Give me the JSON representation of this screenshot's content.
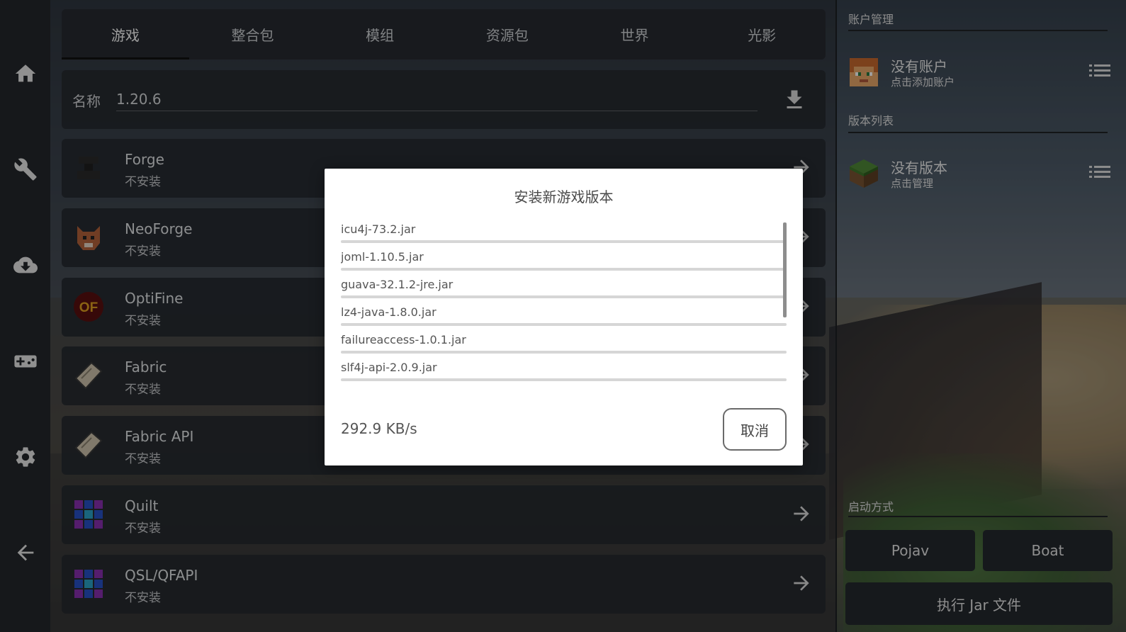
{
  "sidebar": {
    "items": [
      {
        "icon": "home-icon"
      },
      {
        "icon": "wrench-icon"
      },
      {
        "icon": "cloud-download-icon"
      },
      {
        "icon": "gamepad-icon"
      },
      {
        "icon": "gear-icon"
      },
      {
        "icon": "back-arrow-icon"
      }
    ]
  },
  "tabs": [
    "游戏",
    "整合包",
    "模组",
    "资源包",
    "世界",
    "光影"
  ],
  "active_tab": "游戏",
  "name_field": {
    "label": "名称",
    "value": "1.20.6"
  },
  "loaders": [
    {
      "title": "Forge",
      "status": "不安装",
      "icon": "forge-anvil-icon"
    },
    {
      "title": "NeoForge",
      "status": "不安装",
      "icon": "neoforge-fox-icon"
    },
    {
      "title": "OptiFine",
      "status": "不安装",
      "icon": "optifine-logo-icon"
    },
    {
      "title": "Fabric",
      "status": "不安装",
      "icon": "fabric-scroll-icon"
    },
    {
      "title": "Fabric API",
      "status": "不安装",
      "icon": "fabric-api-scroll-icon"
    },
    {
      "title": "Quilt",
      "status": "不安装",
      "icon": "quilt-patchwork-icon"
    },
    {
      "title": "QSL/QFAPI",
      "status": "不安装",
      "icon": "qsl-patchwork-icon"
    }
  ],
  "right_panel": {
    "account_section": "账户管理",
    "account": {
      "name": "没有账户",
      "sub": "点击添加账户"
    },
    "version_section": "版本列表",
    "version": {
      "name": "没有版本",
      "sub": "点击管理"
    },
    "launch_section": "启动方式",
    "launch_buttons": [
      "Pojav",
      "Boat"
    ],
    "jar_button": "执行 Jar 文件"
  },
  "dialog": {
    "title": "安装新游戏版本",
    "files": [
      "icu4j-73.2.jar",
      "joml-1.10.5.jar",
      "guava-32.1.2-jre.jar",
      "lz4-java-1.8.0.jar",
      "failureaccess-1.0.1.jar",
      "slf4j-api-2.0.9.jar"
    ],
    "speed": "292.9 KB/s",
    "cancel_label": "取消"
  },
  "colors": {
    "rail_bg": "#24282d",
    "panel_bg": "#262a30",
    "dialog_bg": "#ffffff"
  }
}
